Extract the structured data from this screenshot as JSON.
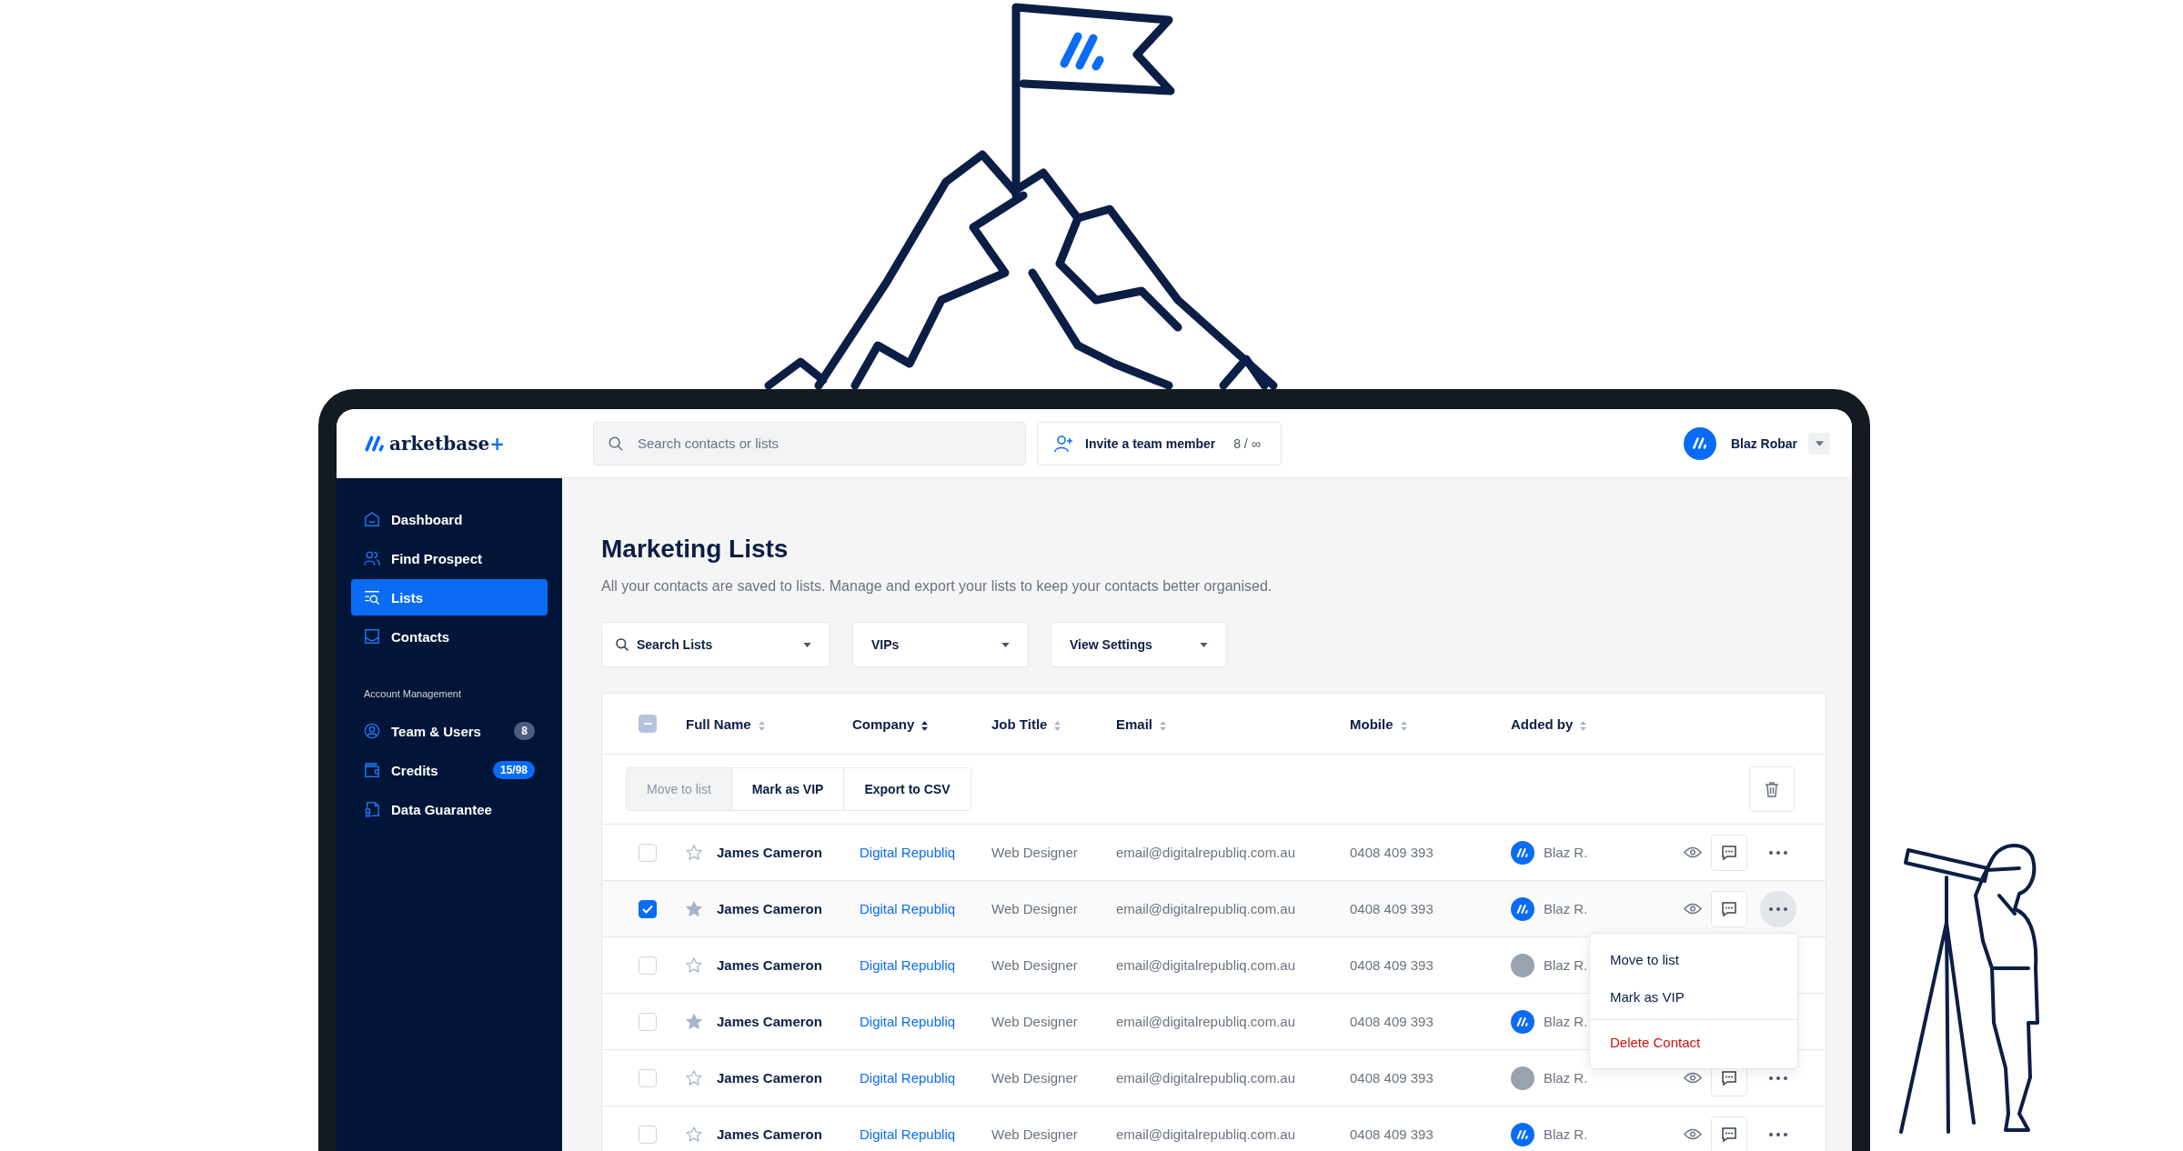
{
  "app": {
    "logo": {
      "name": "arketbase",
      "suffix": "+"
    },
    "search": {
      "placeholder": "Search contacts or lists"
    },
    "invite": {
      "label": "Invite a team member",
      "count": "8 / ∞"
    },
    "user": {
      "name": "Blaz Robar"
    }
  },
  "sidebar": {
    "items": [
      {
        "label": "Dashboard",
        "selected": false
      },
      {
        "label": "Find Prospect",
        "selected": false
      },
      {
        "label": "Lists",
        "selected": true
      },
      {
        "label": "Contacts",
        "selected": false
      }
    ],
    "section_title": "Account Management",
    "account_items": [
      {
        "label": "Team & Users",
        "selected": false,
        "badge": "8",
        "color": "#4b5e82"
      },
      {
        "label": "Credits",
        "selected": false,
        "badge": "15/98",
        "color": "#0a6cf5"
      },
      {
        "label": "Data Guarantee",
        "selected": false
      }
    ]
  },
  "page": {
    "title": "Marketing Lists",
    "description": "All your contacts are saved to lists. Manage and export your lists to keep your contacts better organised.",
    "filters": [
      {
        "label": "Search Lists",
        "kind": "search"
      },
      {
        "label": "VIPs",
        "kind": "select"
      },
      {
        "label": "View Settings",
        "kind": "select"
      }
    ]
  },
  "table": {
    "select_all": {
      "indeterminate": true
    },
    "columns": [
      {
        "label": "Full Name",
        "sorted": false
      },
      {
        "label": "Company",
        "sorted": true
      },
      {
        "label": "Job Title",
        "sorted": false
      },
      {
        "label": "Email",
        "sorted": false
      },
      {
        "label": "Mobile",
        "sorted": false
      },
      {
        "label": "Added by",
        "sorted": false
      }
    ],
    "bulk_actions": [
      {
        "label": "Move to list",
        "disabled": true
      },
      {
        "label": "Mark as VIP",
        "disabled": false
      },
      {
        "label": "Export to CSV",
        "disabled": false
      }
    ],
    "rows": [
      {
        "checked": false,
        "starred": false,
        "name": "James Cameron",
        "company": "Digital Republiq",
        "job_title": "Web Designer",
        "email": "email@digitalrepubliq.com.au",
        "mobile": "0408 409 393",
        "added_by": "Blaz R.",
        "photo_avatar": false,
        "menu_open": false
      },
      {
        "checked": true,
        "starred": true,
        "name": "James Cameron",
        "company": "Digital Republiq",
        "job_title": "Web Designer",
        "email": "email@digitalrepubliq.com.au",
        "mobile": "0408 409 393",
        "added_by": "Blaz R.",
        "photo_avatar": false,
        "menu_open": true
      },
      {
        "checked": false,
        "starred": false,
        "name": "James Cameron",
        "company": "Digital Republiq",
        "job_title": "Web Designer",
        "email": "email@digitalrepubliq.com.au",
        "mobile": "0408 409 393",
        "added_by": "Blaz R.",
        "photo_avatar": true,
        "menu_open": false
      },
      {
        "checked": false,
        "starred": true,
        "name": "James Cameron",
        "company": "Digital Republiq",
        "job_title": "Web Designer",
        "email": "email@digitalrepubliq.com.au",
        "mobile": "0408 409 393",
        "added_by": "Blaz R.",
        "photo_avatar": false,
        "menu_open": false
      },
      {
        "checked": false,
        "starred": false,
        "name": "James Cameron",
        "company": "Digital Republiq",
        "job_title": "Web Designer",
        "email": "email@digitalrepubliq.com.au",
        "mobile": "0408 409 393",
        "added_by": "Blaz R.",
        "photo_avatar": true,
        "menu_open": false
      },
      {
        "checked": false,
        "starred": false,
        "name": "James Cameron",
        "company": "Digital Republiq",
        "job_title": "Web Designer",
        "email": "email@digitalrepubliq.com.au",
        "mobile": "0408 409 393",
        "added_by": "Blaz R.",
        "photo_avatar": false,
        "menu_open": false
      }
    ],
    "context_menu": {
      "items": [
        {
          "label": "Move to list",
          "kind": "normal"
        },
        {
          "label": "Mark as VIP",
          "kind": "normal"
        },
        {
          "label": "Delete Contact",
          "kind": "danger"
        }
      ]
    }
  }
}
